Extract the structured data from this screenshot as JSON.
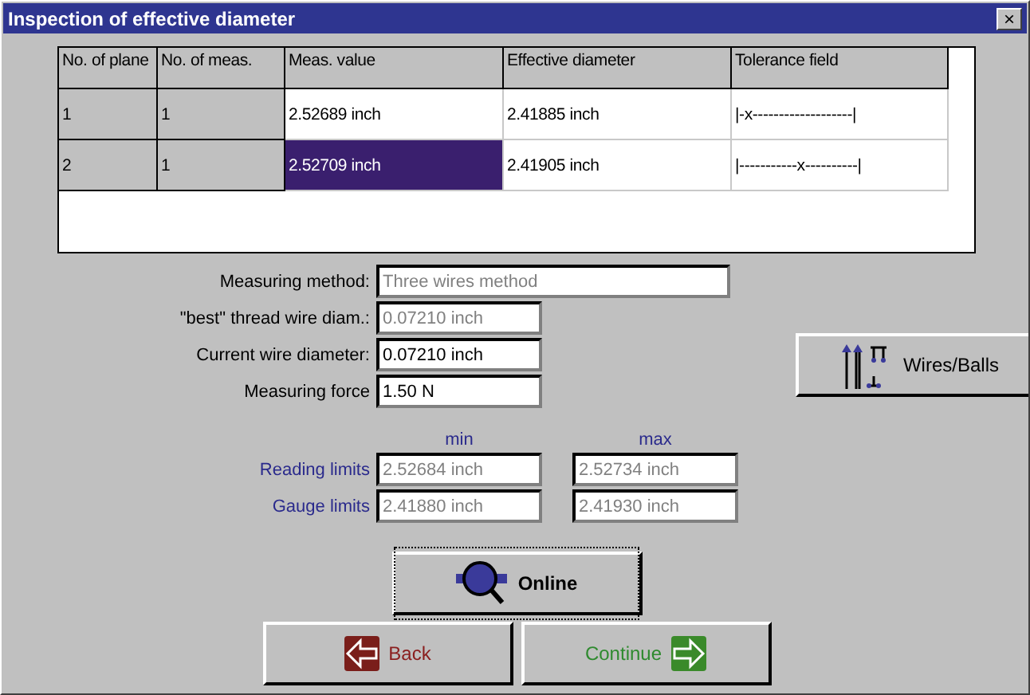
{
  "window": {
    "title": "Inspection of effective diameter",
    "close_label": "×"
  },
  "table": {
    "columns": [
      "No. of plane",
      "No. of meas.",
      "Meas. value",
      "Effective diameter",
      "Tolerance field"
    ],
    "rows": [
      {
        "plane": "1",
        "meas": "1",
        "value": "2.52689 inch",
        "effective": "2.41885 inch",
        "tolerance": "|-x-------------------|",
        "selected": false
      },
      {
        "plane": "2",
        "meas": "1",
        "value": "2.52709 inch",
        "effective": "2.41905 inch",
        "tolerance": "|-----------x----------|",
        "selected": true
      }
    ]
  },
  "fields": [
    {
      "label": "Measuring method:",
      "value": "Three wires method",
      "disabled": true,
      "kind": "wide"
    },
    {
      "label": "\"best\" thread wire diam.:",
      "value": "0.07210 inch",
      "disabled": true,
      "kind": "narrow"
    },
    {
      "label": "Current wire diameter:",
      "value": "0.07210 inch",
      "disabled": false,
      "kind": "narrow"
    },
    {
      "label": "Measuring force",
      "value": "1.50 N",
      "disabled": false,
      "kind": "narrow"
    }
  ],
  "limits": {
    "min_label": "min",
    "max_label": "max",
    "rows": [
      {
        "label": "Reading limits",
        "min": "2.52684 inch",
        "max": "2.52734 inch"
      },
      {
        "label": "Gauge limits",
        "min": "2.41880 inch",
        "max": "2.41930 inch"
      }
    ]
  },
  "buttons": {
    "wires": "Wires/Balls",
    "online": "Online",
    "back": "Back",
    "continue": "Continue"
  }
}
